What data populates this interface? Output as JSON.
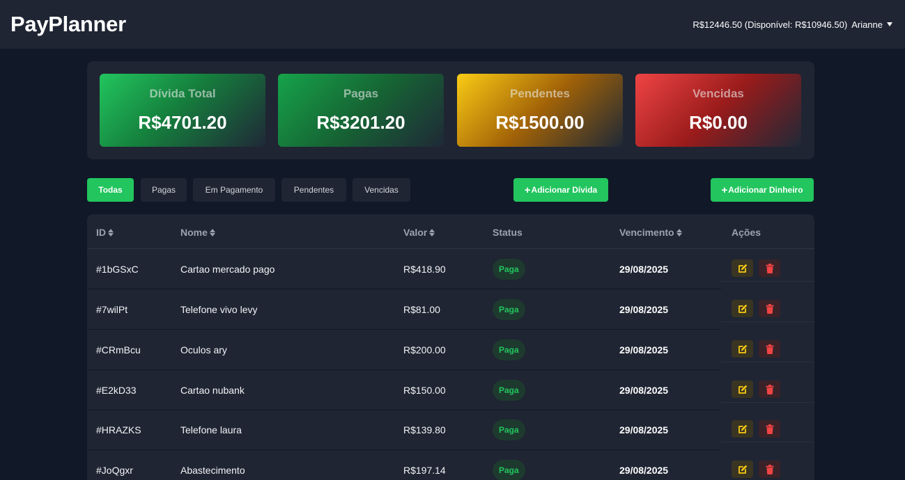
{
  "app": {
    "title": "PayPlanner",
    "balance": "R$12446.50 (Disponível: R$10946.50)",
    "user": "Arianne"
  },
  "summary": {
    "total": {
      "label": "Dívida Total",
      "value": "R$4701.20"
    },
    "paid": {
      "label": "Pagas",
      "value": "R$3201.20"
    },
    "pending": {
      "label": "Pendentes",
      "value": "R$1500.00"
    },
    "overdue": {
      "label": "Vencidas",
      "value": "R$0.00"
    }
  },
  "filters": [
    "Todas",
    "Pagas",
    "Em Pagamento",
    "Pendentes",
    "Vencidas"
  ],
  "active_filter": "Todas",
  "actions": {
    "add_debt": "Adicionar Dívida",
    "add_money": "Adicionar Dinheiro"
  },
  "table": {
    "headers": [
      "ID",
      "Nome",
      "Valor",
      "Status",
      "Vencimento",
      "Ações"
    ],
    "rows": [
      {
        "id": "#1bGSxC",
        "name": "Cartao mercado pago",
        "value": "R$418.90",
        "status": "Paga",
        "due": "29/08/2025"
      },
      {
        "id": "#7wilPt",
        "name": "Telefone vivo levy",
        "value": "R$81.00",
        "status": "Paga",
        "due": "29/08/2025"
      },
      {
        "id": "#CRmBcu",
        "name": "Oculos ary",
        "value": "R$200.00",
        "status": "Paga",
        "due": "29/08/2025"
      },
      {
        "id": "#E2kD33",
        "name": "Cartao nubank",
        "value": "R$150.00",
        "status": "Paga",
        "due": "29/08/2025"
      },
      {
        "id": "#HRAZKS",
        "name": "Telefone laura",
        "value": "R$139.80",
        "status": "Paga",
        "due": "29/08/2025"
      },
      {
        "id": "#JoQgxr",
        "name": "Abastecimento",
        "value": "R$197.14",
        "status": "Paga",
        "due": "29/08/2025"
      }
    ]
  },
  "colors": {
    "accent": "#22c55e",
    "background": "#111827",
    "surface": "#1f2533",
    "edit": "#facc15",
    "delete": "#ef4444"
  }
}
